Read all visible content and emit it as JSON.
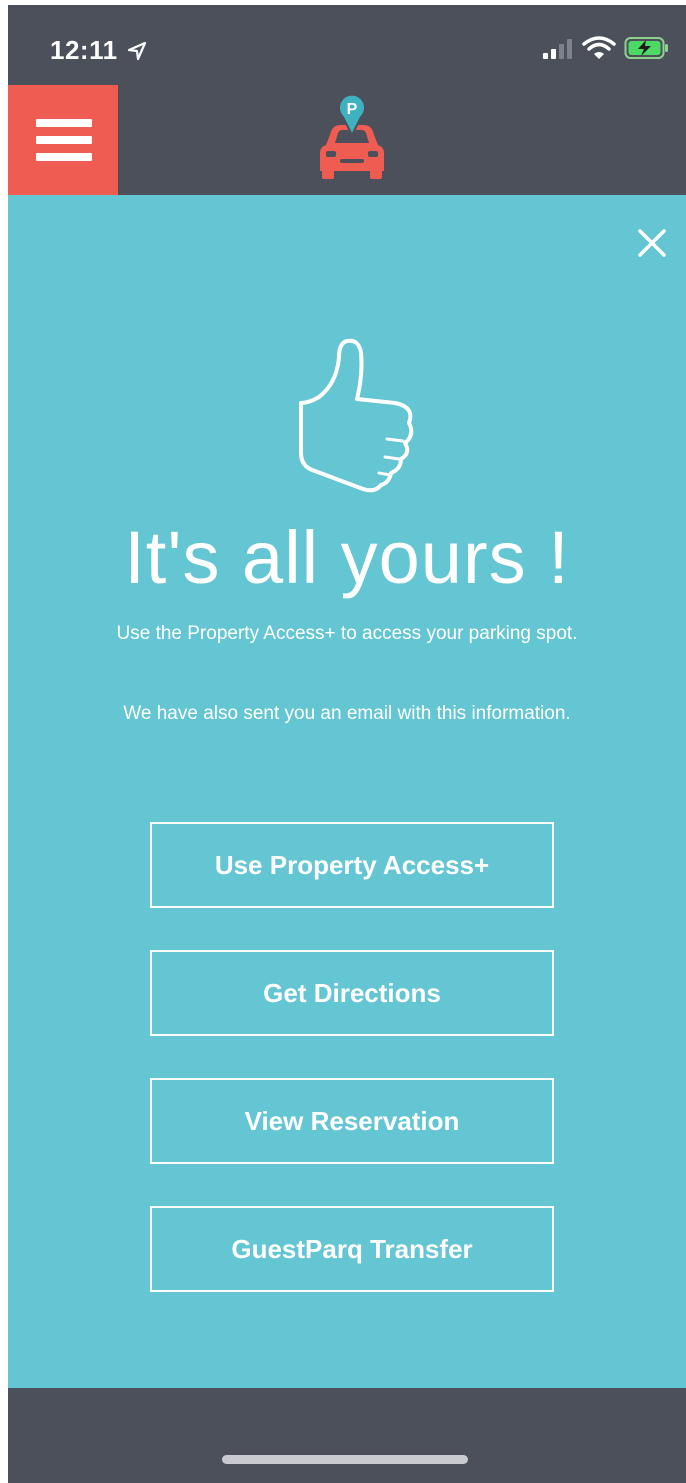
{
  "status_bar": {
    "time": "12:11",
    "icons": [
      "location-arrow-icon",
      "cellular-signal-icon",
      "wifi-icon",
      "battery-charging-icon"
    ]
  },
  "header": {
    "menu_icon": "hamburger-menu-icon",
    "logo_icon": "parking-car-logo",
    "logo_letter": "P"
  },
  "colors": {
    "accent": "#ef5c52",
    "panel": "#64c5d3",
    "background": "#4c505b",
    "text": "#ffffff"
  },
  "confirmation": {
    "close_icon": "close-icon",
    "thumb_icon": "thumbs-up-icon",
    "headline": "It's all yours !",
    "message_1": "Use the Property Access+ to access your parking spot.",
    "message_2": "We have also sent you an email with this information."
  },
  "actions": {
    "property_access": "Use Property Access+",
    "directions": "Get Directions",
    "reservation": "View Reservation",
    "transfer": "GuestParq Transfer"
  }
}
